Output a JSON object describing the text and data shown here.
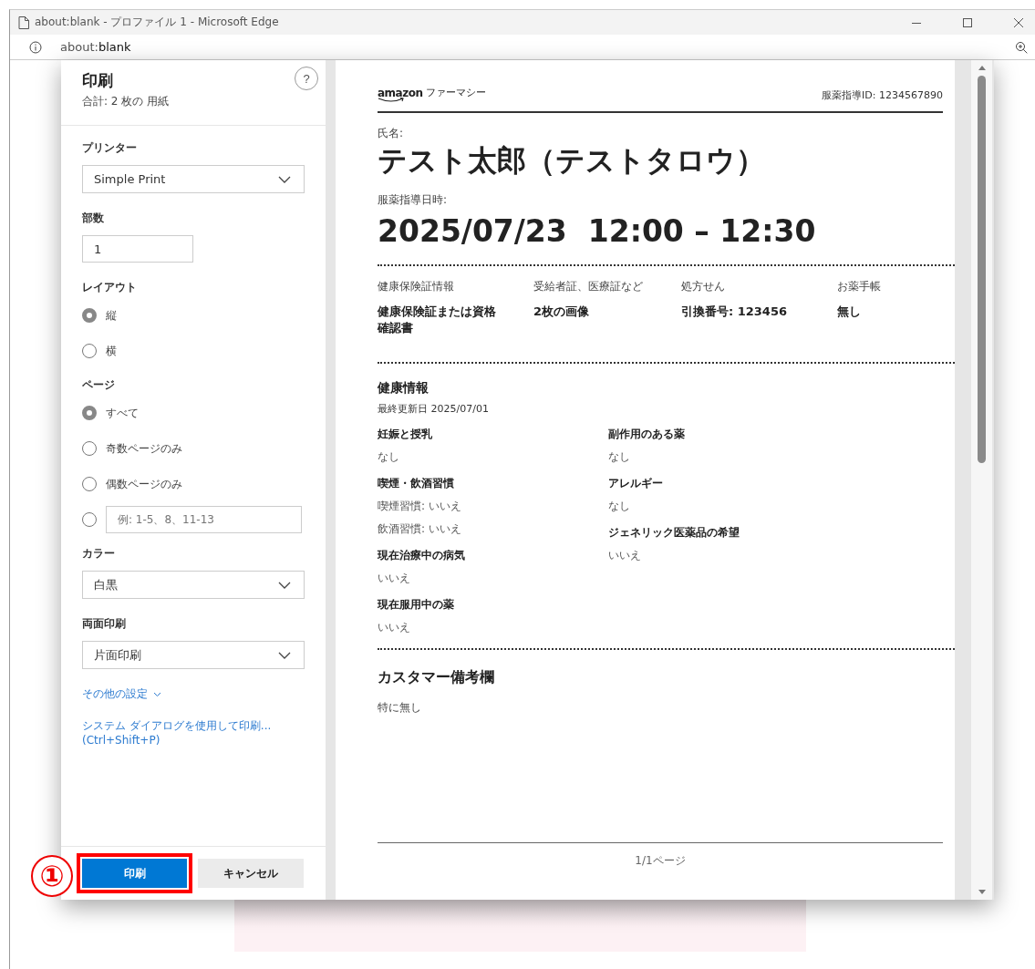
{
  "window": {
    "title": "about:blank - プロファイル 1 - Microsoft Edge"
  },
  "address_bar": {
    "url_prefix": "about:",
    "url_host": "blank"
  },
  "print_dialog": {
    "title": "印刷",
    "summary": "合計: 2 枚の 用紙",
    "help": "?",
    "settings": [
      {
        "kind": "dropdown",
        "label": "プリンター",
        "value": "Simple Print"
      },
      {
        "kind": "number",
        "label": "部数",
        "value": "1"
      },
      {
        "kind": "radio",
        "label": "レイアウト",
        "options": [
          {
            "label": "縦",
            "selected": true
          },
          {
            "label": "横",
            "selected": false
          }
        ]
      },
      {
        "kind": "radio",
        "label": "ページ",
        "options": [
          {
            "label": "すべて",
            "selected": true
          },
          {
            "label": "奇数ページのみ",
            "selected": false
          },
          {
            "label": "偶数ページのみ",
            "selected": false
          },
          {
            "placeholder": "例: 1-5、8、11-13",
            "selected": false
          }
        ]
      },
      {
        "kind": "dropdown",
        "label": "カラー",
        "value": "白黒"
      },
      {
        "kind": "dropdown",
        "label": "両面印刷",
        "value": "片面印刷"
      }
    ],
    "more_settings": "その他の設定",
    "system_dialog_link": "システム ダイアログを使用して印刷... (Ctrl+Shift+P)",
    "buttons": [
      {
        "label": "印刷",
        "kind": "primary",
        "highlighted": true
      },
      {
        "label": "キャンセル",
        "kind": "secondary",
        "highlighted": false
      }
    ]
  },
  "annotation": {
    "label": "①"
  },
  "preview": {
    "logo": "amazon",
    "service": "ファーマシー",
    "guidance_id": "服薬指導ID: 1234567890",
    "name_label": "氏名:",
    "name": "テスト太郎（テストタロウ）",
    "datetime_label": "服薬指導日時:",
    "datetime": "2025/07/23  12:00 – 12:30",
    "documents": [
      {
        "label": "健康保険証情報",
        "value": "健康保険証または資格確認書"
      },
      {
        "label": "受給者証、医療証など",
        "value": "2枚の画像"
      },
      {
        "label": "処方せん",
        "value": "引換番号: 123456"
      },
      {
        "label": "お薬手帳",
        "value": "無し"
      }
    ],
    "health": {
      "title": "健康情報",
      "updated": "最終更新日 2025/07/01",
      "columns": [
        [
          {
            "heading": "妊娠と授乳",
            "values": [
              "なし"
            ]
          },
          {
            "heading": "喫煙・飲酒習慣",
            "values": [
              "喫煙習慣: いいえ",
              "飲酒習慣: いいえ"
            ]
          },
          {
            "heading": "現在治療中の病気",
            "values": [
              "いいえ"
            ]
          },
          {
            "heading": "現在服用中の薬",
            "values": [
              "いいえ"
            ]
          }
        ],
        [
          {
            "heading": "副作用のある薬",
            "values": [
              "なし"
            ]
          },
          {
            "heading": "アレルギー",
            "values": [
              "なし"
            ]
          },
          {
            "heading": "ジェネリック医薬品の希望",
            "values": [
              "いいえ"
            ]
          }
        ]
      ]
    },
    "notes": {
      "title": "カスタマー備考欄",
      "text": "特に無し"
    },
    "footer": "1/1ページ"
  }
}
